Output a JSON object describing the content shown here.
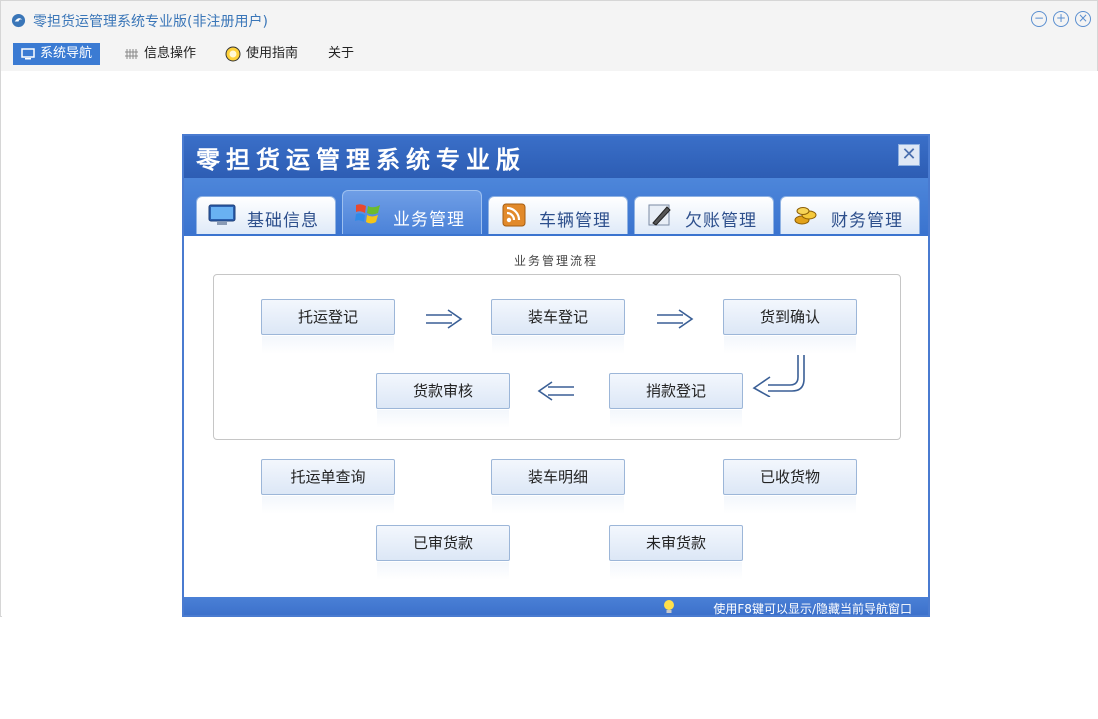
{
  "app": {
    "title": "零担货运管理系统专业版(非注册用户)"
  },
  "menubar": {
    "items": [
      {
        "label": "系统导航",
        "icon": "monitor-icon"
      },
      {
        "label": "信息操作",
        "icon": "grid-icon"
      },
      {
        "label": "使用指南",
        "icon": "help-icon"
      },
      {
        "label": "关于"
      }
    ]
  },
  "nav": {
    "title": "零担货运管理系统专业版",
    "tabs": [
      {
        "label": "基础信息",
        "icon": "monitor-icon"
      },
      {
        "label": "业务管理",
        "icon": "windows-flag-icon"
      },
      {
        "label": "车辆管理",
        "icon": "rss-icon"
      },
      {
        "label": "欠账管理",
        "icon": "pencil-icon"
      },
      {
        "label": "财务管理",
        "icon": "coins-icon"
      }
    ],
    "section_title": "业务管理流程",
    "flow": {
      "row1": [
        "托运登记",
        "装车登记",
        "货到确认"
      ],
      "row2": [
        "货款审核",
        "捎款登记"
      ]
    },
    "buttons": {
      "row1": [
        "托运单查询",
        "装车明细",
        "已收货物"
      ],
      "row2": [
        "已审货款",
        "未审货款"
      ]
    },
    "footer_tip": "使用F8键可以显示/隐藏当前导航窗口"
  },
  "colors": {
    "accent": "#3b7bd3",
    "panel_blue": "#3a6fc8",
    "title_text": "#3a76b8"
  }
}
